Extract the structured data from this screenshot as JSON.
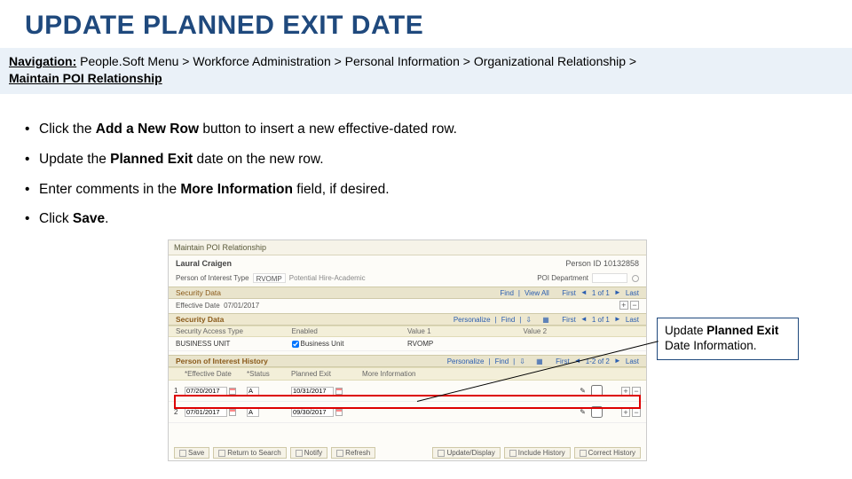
{
  "title": "UPDATE PLANNED EXIT DATE",
  "nav": {
    "label": "Navigation:",
    "path": "People.Soft Menu > Workforce Administration > Personal Information > Organizational Relationship >",
    "last": "Maintain POI Relationship"
  },
  "bullets": {
    "b1a": "Click the ",
    "b1b": "Add a New Row",
    "b1c": " button to insert a new effective-dated row.",
    "b2a": "Update the ",
    "b2b": "Planned Exit",
    "b2c": " date on the new row.",
    "b3a": "Enter comments in the ",
    "b3b": "More Information",
    "b3c": " field, if desired.",
    "b4a": "Click ",
    "b4b": "Save",
    "b4c": "."
  },
  "callout": {
    "t1": "Update ",
    "t2": "Planned Exit",
    "t3": " Date Information."
  },
  "ps": {
    "pageTitle": "Maintain POI Relationship",
    "personName": "Laural Craigen",
    "personIdLbl": "Person ID",
    "personId": "10132858",
    "poiTypeLbl": "Person of Interest Type",
    "poiTypeCode": "RVOMP",
    "poiTypeDesc": "Potential Hire-Academic",
    "poiDeptLbl": "POI Department",
    "sectionSecurity": "Security Data",
    "links": {
      "find": "Find",
      "viewAll": "View All",
      "first": "First",
      "oneOfOne": "1 of 1",
      "last": "Last",
      "personalize": "Personalize",
      "oneTwo": "1-2 of 2"
    },
    "effDateLbl": "Effective Date",
    "effDate": "07/01/2017",
    "gridTitle": "Security Data",
    "cols": {
      "c1": "Security Access Type",
      "c2": "Enabled",
      "c3": "Value 1",
      "c4": "Value 2"
    },
    "row": {
      "type": "BUSINESS UNIT",
      "v1desc": "Business Unit",
      "v1": "RVOMP"
    },
    "poiHist": "Person of Interest History",
    "poiCols": {
      "c1": "*Effective Date",
      "c2": "*Status",
      "c3": "Planned Exit",
      "c4": "More Information"
    },
    "poiRows": [
      {
        "n": "1",
        "eff": "07/20/2017",
        "status": "A",
        "exit": "10/31/2017",
        "more": ""
      },
      {
        "n": "2",
        "eff": "07/01/2017",
        "status": "A",
        "exit": "09/30/2017",
        "more": ""
      }
    ],
    "footer": {
      "save": "Save",
      "return": "Return to Search",
      "notify": "Notify",
      "refresh": "Refresh",
      "update": "Update/Display",
      "include": "Include History",
      "correct": "Correct History"
    }
  }
}
